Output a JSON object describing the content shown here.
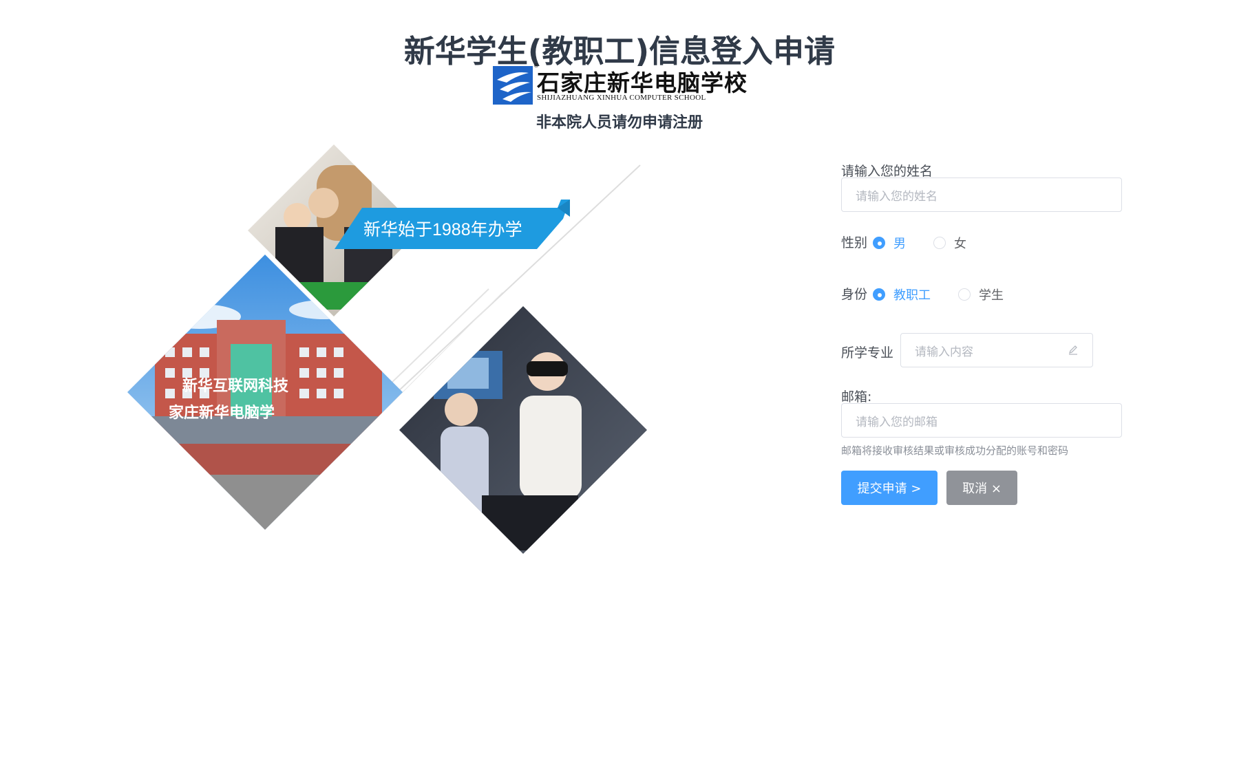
{
  "header": {
    "title": "新华学生(教职工)信息登入申请",
    "logo_cn": "石家庄新华电脑学校",
    "logo_en": "SHIJIAZHUANG XINHUA COMPUTER SCHOOL",
    "logo_reg": "®",
    "notice": "非本院人员请勿申请注册"
  },
  "banner": {
    "slogan": "新华始于1988年办学",
    "building_sign": "新华互联网科技",
    "building_name": "家庄新华电脑学"
  },
  "form": {
    "name": {
      "label": "请输入您的姓名",
      "placeholder": "请输入您的姓名",
      "value": ""
    },
    "gender": {
      "label": "性别",
      "options": [
        "男",
        "女"
      ],
      "selected": "男"
    },
    "identity": {
      "label": "身份",
      "options": [
        "教职工",
        "学生"
      ],
      "selected": "教职工"
    },
    "major": {
      "label": "所学专业",
      "placeholder": "请输入内容",
      "icon": "pencil-icon"
    },
    "email": {
      "label": "邮箱:",
      "placeholder": "请输入您的邮箱",
      "hint": "邮箱将接收审核结果或审核成功分配的账号和密码"
    },
    "submit_label": "提交申请 >",
    "cancel_label": "取消 ×"
  },
  "colors": {
    "primary": "#409eff",
    "cancel": "#909399",
    "title": "#303a48",
    "banner": "#1e9be0"
  }
}
